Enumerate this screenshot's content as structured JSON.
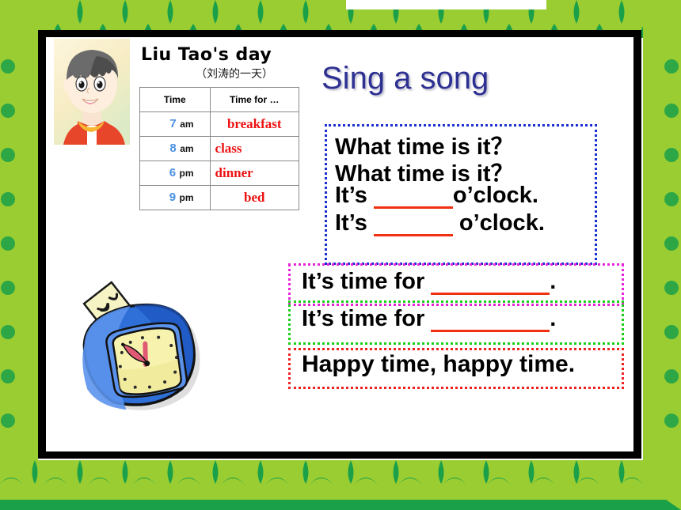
{
  "slide": {
    "title": "Sing a song",
    "title_color": "#2e3192",
    "frame_color": "#000000",
    "border_theme": "green-leaf-scallop",
    "border_colors": {
      "light": "#9acd32",
      "dark": "#1ba04a"
    }
  },
  "schedule": {
    "heading": "Liu Tao's day",
    "subheading": "（刘涛的一天）",
    "columns": [
      "Time",
      "Time for …"
    ],
    "number_color": "#4a90e2",
    "activity_color": "#ee1111",
    "rows": [
      {
        "hour": "7",
        "period": "am",
        "activity": "breakfast"
      },
      {
        "hour": "8",
        "period": "am",
        "activity": "class"
      },
      {
        "hour": "6",
        "period": "pm",
        "activity": "dinner"
      },
      {
        "hour": "9",
        "period": "pm",
        "activity": "bed"
      }
    ]
  },
  "lyrics": {
    "box_blue": {
      "border_color": "#1a2fd0",
      "line1": "What time is it？",
      "line2": "What time is it？",
      "line3_prefix": "It’s",
      "line3_suffix": "o’clock.",
      "line4_prefix": "It’s",
      "line4_suffix": "o’clock."
    },
    "box_magenta": {
      "border_color": "#e522d8",
      "prefix": "It’s time for",
      "suffix": "."
    },
    "box_green": {
      "border_color": "#18d018",
      "prefix": "It’s time for",
      "suffix": "."
    },
    "box_red": {
      "border_color": "#ef2020",
      "text": "Happy time, happy time."
    },
    "blank_underline_color": "#f03010"
  },
  "illustrations": {
    "boy": "cartoon-boy-face",
    "clock": "cartoon-blue-alarm-clock"
  }
}
